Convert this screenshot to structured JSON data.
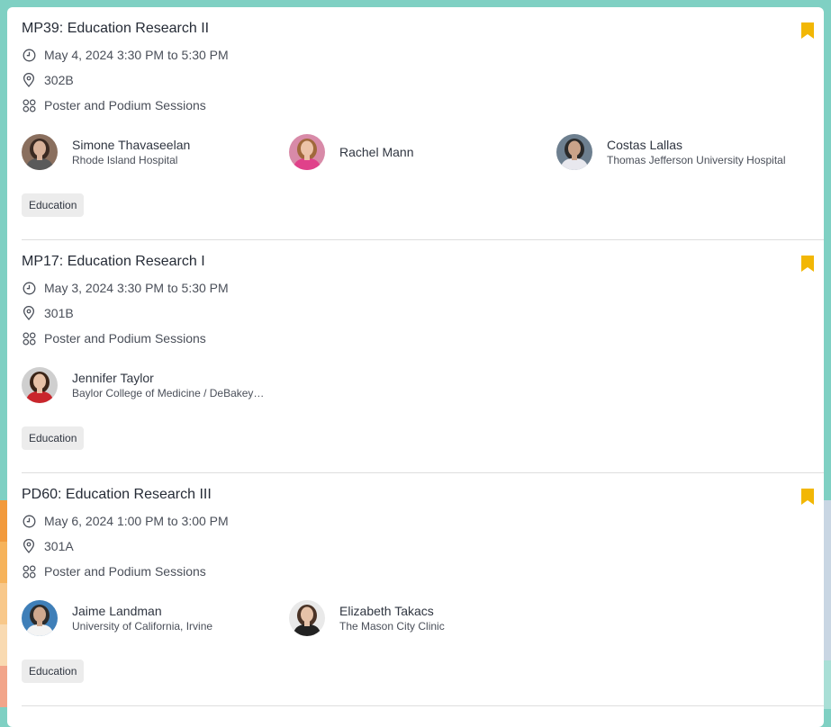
{
  "colors": {
    "bookmark": "#f2b705",
    "background_teal": "#7fd0c3",
    "tag_bg": "#ececec",
    "left_stripes": [
      "#f29a3c",
      "#f6b35b",
      "#f8c88a",
      "#f9dab1",
      "#f2a58a"
    ]
  },
  "sessions": [
    {
      "title": "MP39: Education Research II",
      "time": "May 4, 2024 3:30 PM to 5:30 PM",
      "location": "302B",
      "category": "Poster and Podium Sessions",
      "tag": "Education",
      "speakers": [
        {
          "name": "Simone Thavaseelan",
          "org": "Rhode Island Hospital",
          "avatar": {
            "bg": "#8a6f5e",
            "hair": "#3b2a22",
            "skin": "#d9b29a",
            "shirt": "#5a5a5a"
          }
        },
        {
          "name": "Rachel Mann",
          "org": "",
          "avatar": {
            "bg": "#d88aa8",
            "hair": "#a0683b",
            "skin": "#edc3a8",
            "shirt": "#e0418a"
          }
        },
        {
          "name": "Costas Lallas",
          "org": "Thomas Jefferson University Hospital",
          "avatar": {
            "bg": "#6d7f8f",
            "hair": "#2a2a2a",
            "skin": "#caa389",
            "shirt": "#e8e8ee"
          }
        }
      ]
    },
    {
      "title": "MP17: Education Research I",
      "time": "May 3, 2024 3:30 PM to 5:30 PM",
      "location": "301B",
      "category": "Poster and Podium Sessions",
      "tag": "Education",
      "speakers": [
        {
          "name": "Jennifer Taylor",
          "org": "Baylor College of Medicine / DeBakey…",
          "avatar": {
            "bg": "#cfcfcf",
            "hair": "#3a2417",
            "skin": "#e7c1a6",
            "shirt": "#c9262c"
          }
        }
      ]
    },
    {
      "title": "PD60: Education Research III",
      "time": "May 6, 2024 1:00 PM to 3:00 PM",
      "location": "301A",
      "category": "Poster and Podium Sessions",
      "tag": "Education",
      "speakers": [
        {
          "name": "Jaime Landman",
          "org": "University of California, Irvine",
          "avatar": {
            "bg": "#3f7fb8",
            "hair": "#2b2b2b",
            "skin": "#cfa88e",
            "shirt": "#f4f4f4"
          }
        },
        {
          "name": "Elizabeth Takacs",
          "org": "The Mason City Clinic",
          "avatar": {
            "bg": "#e9e9e9",
            "hair": "#4a3326",
            "skin": "#e6c2a8",
            "shirt": "#222222"
          }
        }
      ]
    }
  ]
}
